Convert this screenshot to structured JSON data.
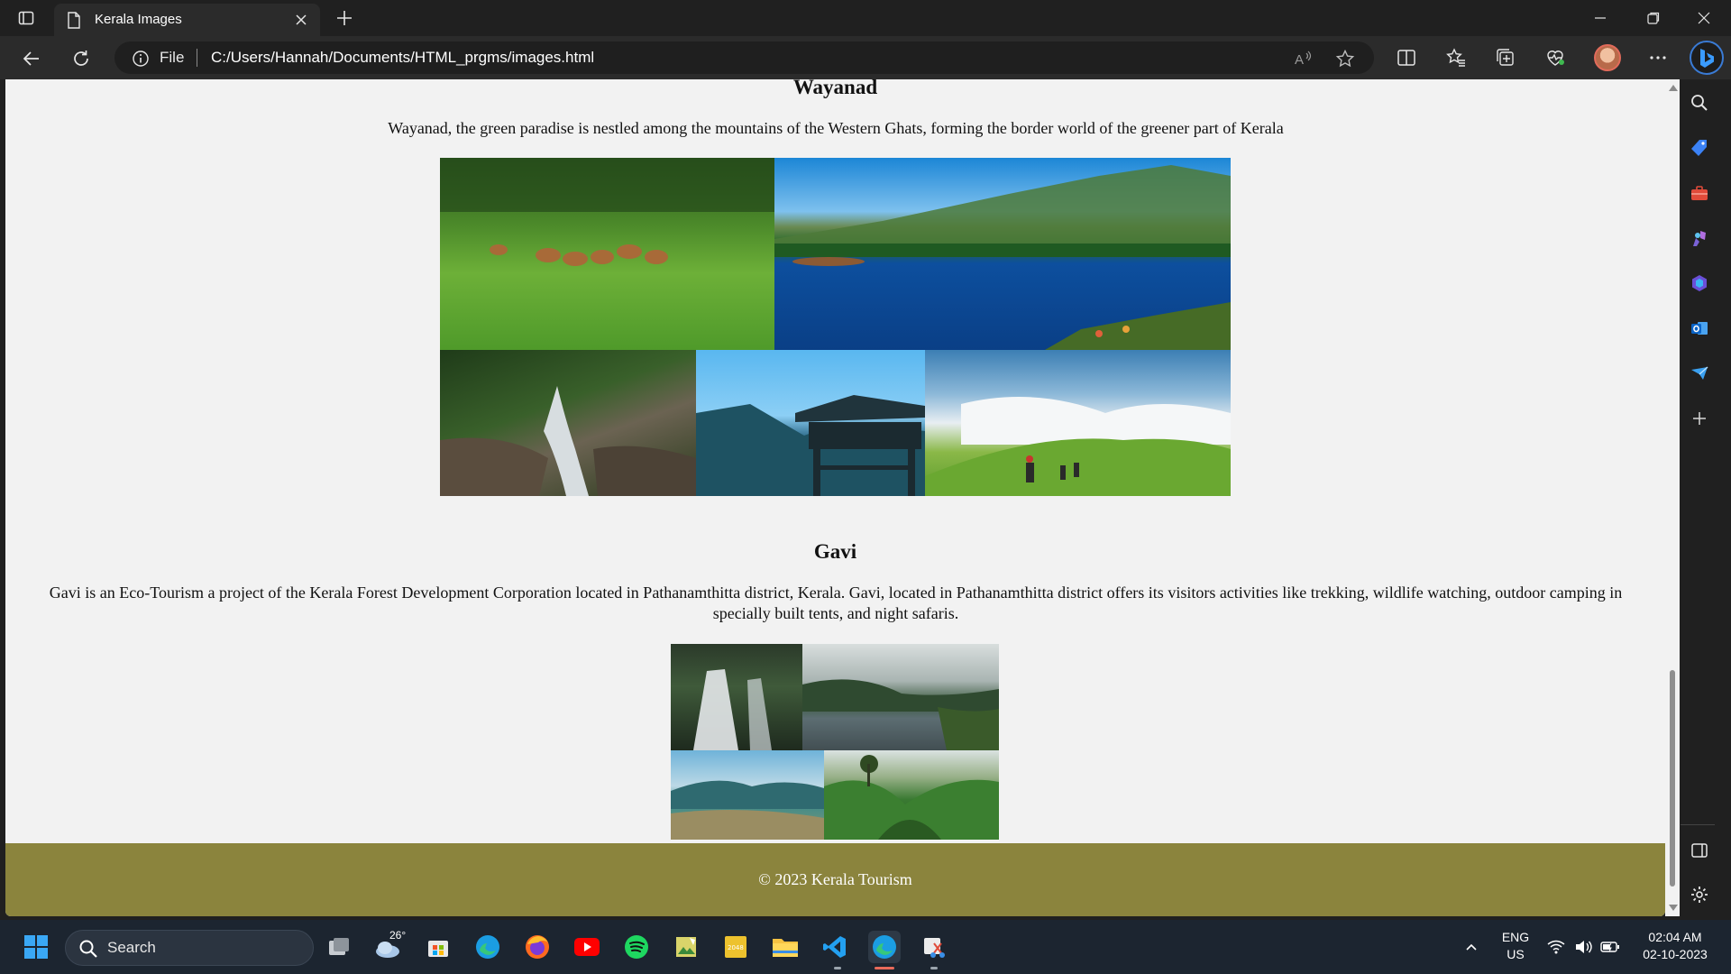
{
  "browser": {
    "tab_title": "Kerala Images",
    "file_label": "File",
    "url": "C:/Users/Hannah/Documents/HTML_prgms/images.html"
  },
  "page": {
    "sections": [
      {
        "title": "Wayanad",
        "text": "Wayanad, the green paradise is nestled among the mountains of the Western Ghats, forming the border world of the greener part of Kerala"
      },
      {
        "title": "Gavi",
        "text": "Gavi is an Eco-Tourism a project of the Kerala Forest Development Corporation located in Pathanamthitta district, Kerala. Gavi, located in Pathanamthitta district offers its visitors activities like trekking, wildlife watching, outdoor camping in specially built tents, and night safaris."
      }
    ],
    "footer": "© 2023 Kerala Tourism"
  },
  "taskbar": {
    "search_label": "Search",
    "weather_temp": "26°",
    "language_line1": "ENG",
    "language_line2": "US",
    "time": "02:04 AM",
    "date": "02-10-2023"
  }
}
